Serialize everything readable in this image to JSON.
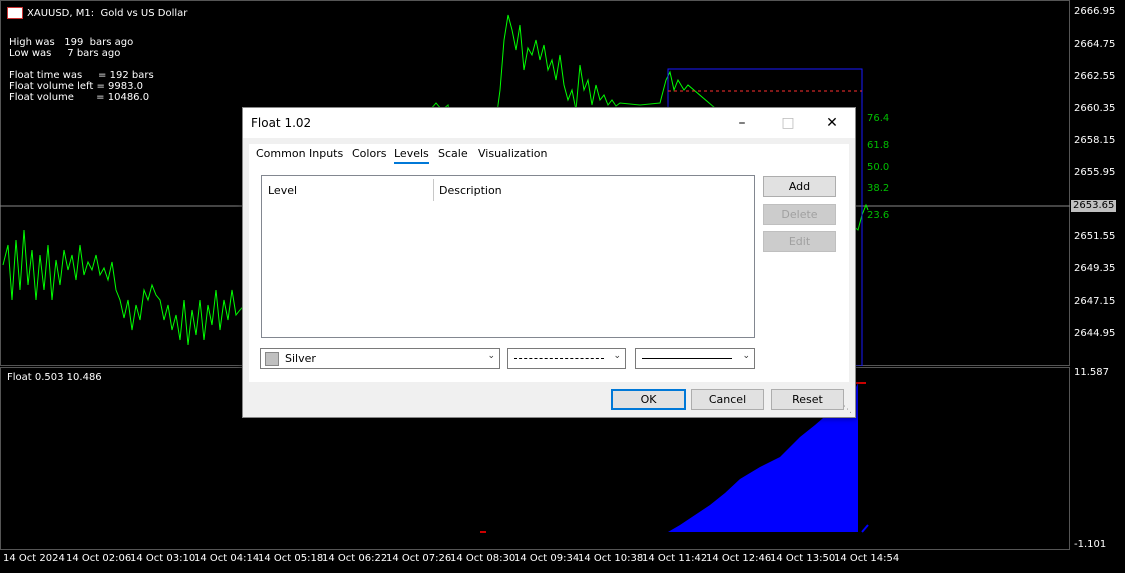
{
  "chart": {
    "header": "XAUUSD, M1:  Gold vs US Dollar",
    "info": {
      "high_was": "High was   199  bars ago",
      "low_was": "Low was     7 bars ago",
      "float_time": "Float time was     = 192 bars",
      "float_volume_left": "Float volume left = 9983.0",
      "float_volume": "Float volume       = 10486.0"
    },
    "price_axis": [
      "2666.95",
      "2664.75",
      "2662.55",
      "2660.35",
      "2658.15",
      "2655.95",
      "2653.65",
      "2651.55",
      "2649.35",
      "2647.15",
      "2644.95"
    ],
    "current_price": "2653.65",
    "fib_levels": [
      "76.4",
      "61.8",
      "50.0",
      "38.2",
      "23.6"
    ],
    "subwindow": {
      "label": "Float 0.503 10.486",
      "axis_top": "11.587",
      "axis_bottom": "-1.101"
    },
    "time_axis": [
      "14 Oct 2024",
      "14 Oct 02:06",
      "14 Oct 03:10",
      "14 Oct 04:14",
      "14 Oct 05:18",
      "14 Oct 06:22",
      "14 Oct 07:26",
      "14 Oct 08:30",
      "14 Oct 09:34",
      "14 Oct 10:38",
      "14 Oct 11:42",
      "14 Oct 12:46",
      "14 Oct 13:50",
      "14 Oct 14:54"
    ],
    "colors": {
      "price_line": "#00ff00",
      "fib": "#00c000",
      "volume": "#0000ff",
      "range_box": "#1a1aff"
    }
  },
  "dialog": {
    "title": "Float 1.02",
    "tabs": [
      "Common",
      "Inputs",
      "Colors",
      "Levels",
      "Scale",
      "Visualization"
    ],
    "active_tab": "Levels",
    "columns": [
      "Level",
      "Description"
    ],
    "buttons": {
      "add": "Add",
      "delete": "Delete",
      "edit": "Edit"
    },
    "color_select": "Silver",
    "footer": {
      "ok": "OK",
      "cancel": "Cancel",
      "reset": "Reset"
    }
  }
}
